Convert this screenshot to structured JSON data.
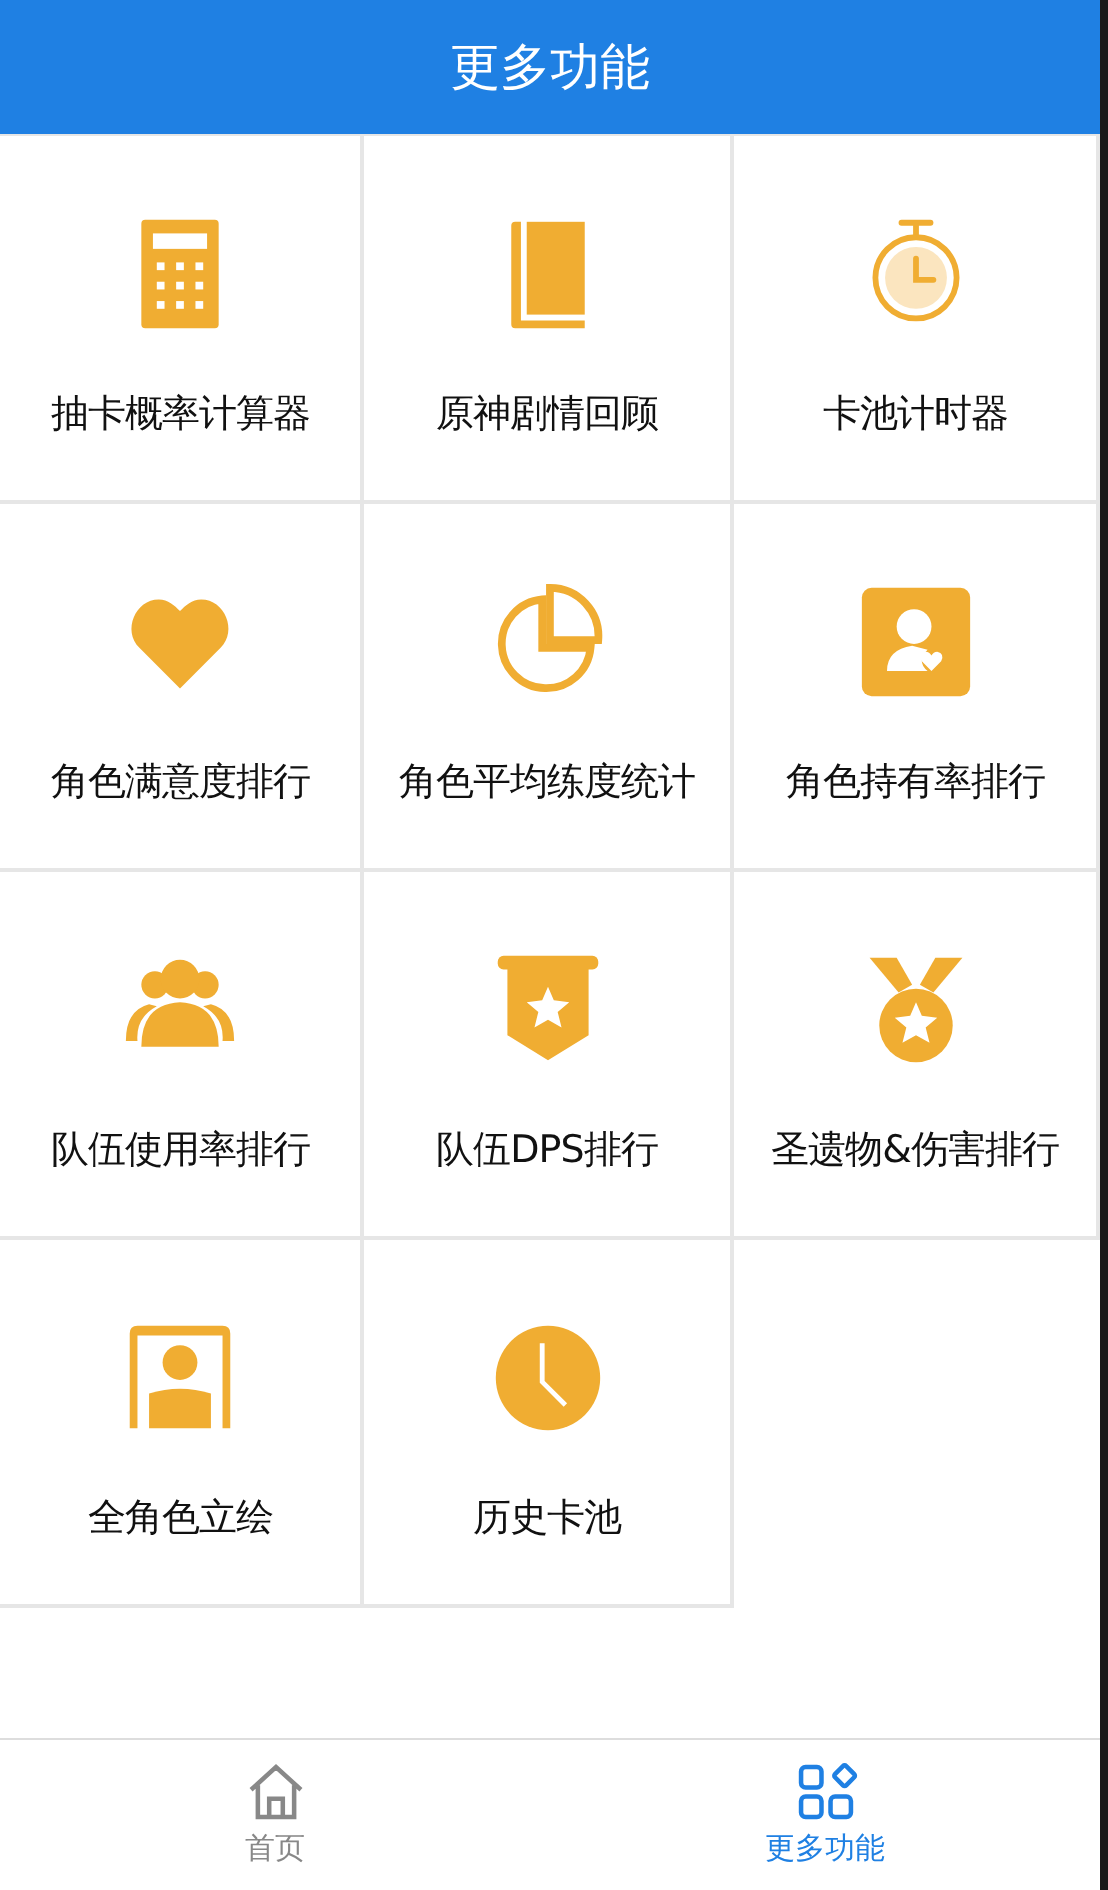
{
  "header": {
    "title": "更多功能"
  },
  "features": [
    {
      "kind": "calculator",
      "label": "抽卡概率计算器"
    },
    {
      "kind": "book",
      "label": "原神剧情回顾"
    },
    {
      "kind": "stopwatch",
      "label": "卡池计时器"
    },
    {
      "kind": "heart",
      "label": "角色满意度排行"
    },
    {
      "kind": "pie",
      "label": "角色平均练度统计"
    },
    {
      "kind": "person-card",
      "label": "角色持有率排行"
    },
    {
      "kind": "group",
      "label": "队伍使用率排行"
    },
    {
      "kind": "banner",
      "label": "队伍DPS排行"
    },
    {
      "kind": "medal",
      "label": "圣遗物&伤害排行"
    },
    {
      "kind": "portrait",
      "label": "全角色立绘"
    },
    {
      "kind": "clock",
      "label": "历史卡池"
    }
  ],
  "tabs": [
    {
      "kind": "home",
      "label": "首页",
      "selected": false
    },
    {
      "kind": "apps",
      "label": "更多功能",
      "selected": true
    }
  ]
}
